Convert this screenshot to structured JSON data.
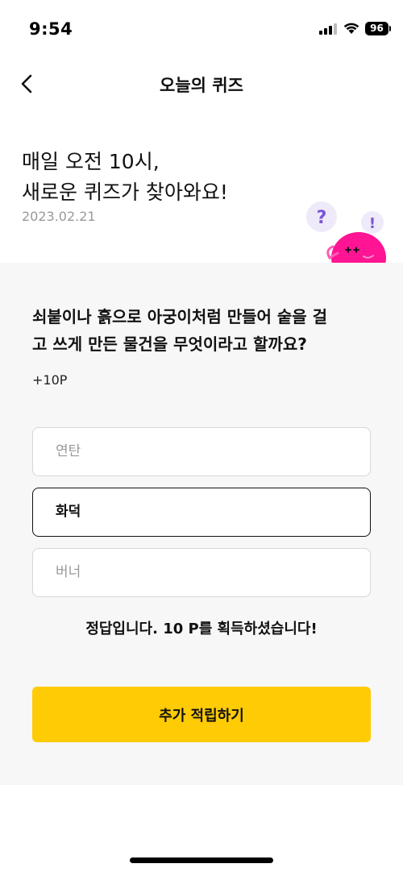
{
  "status_bar": {
    "time": "9:54",
    "battery": "96"
  },
  "nav": {
    "title": "오늘의 퀴즈",
    "back_icon": "chevron-left-icon"
  },
  "header": {
    "headline_line1": "매일 오전 10시,",
    "headline_line2": "새로운 퀴즈가 찾아와요!",
    "date": "2023.02.21",
    "mascot": {
      "question_mark": "?",
      "exclamation_mark": "!",
      "body_color": "#ff1493",
      "bubble_color": "#eeeaf9",
      "mark_color": "#7a56d6"
    }
  },
  "quiz": {
    "question_line1": "쇠붙이나 흙으로 아궁이처럼 만들어 숱을 걸",
    "question_line2": "고 쓰게 만든 물건을 무엇이라고 할까요?",
    "points": "+10P",
    "options": [
      {
        "label": "연탄",
        "selected": false
      },
      {
        "label": "화덕",
        "selected": true
      },
      {
        "label": "버너",
        "selected": false
      }
    ],
    "result": "정답입니다. 10 P를 획득하셨습니다!",
    "cta_label": "추가 적립하기",
    "accent_color": "#ffcb05"
  }
}
